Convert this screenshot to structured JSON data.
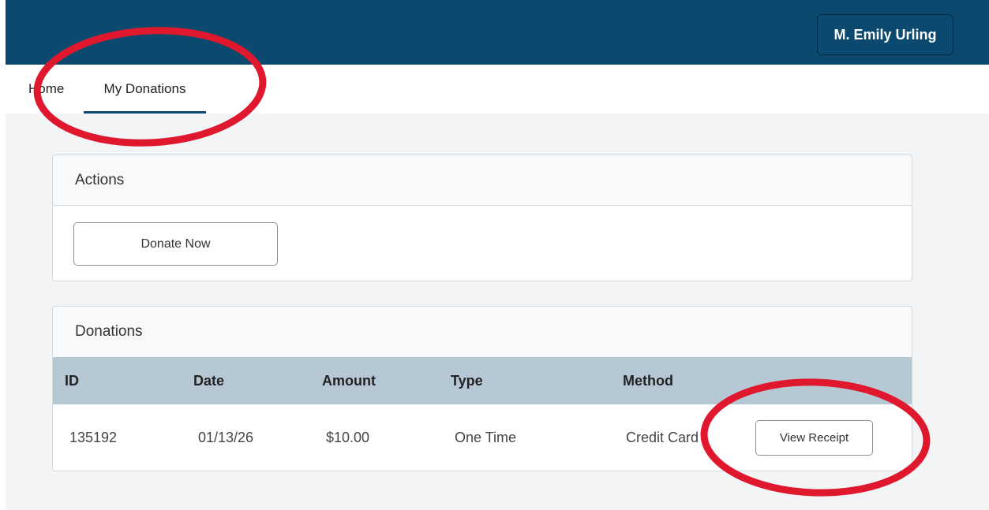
{
  "header": {
    "user_name": "M. Emily Urling",
    "brand_color": "#0b4a6e"
  },
  "nav": {
    "items": [
      {
        "label": "Home",
        "active": false
      },
      {
        "label": "My Donations",
        "active": true
      }
    ]
  },
  "actions_card": {
    "title": "Actions",
    "donate_label": "Donate Now"
  },
  "donations_card": {
    "title": "Donations",
    "columns": [
      "ID",
      "Date",
      "Amount",
      "Type",
      "Method"
    ],
    "rows": [
      {
        "id": "135192",
        "date": "01/13/26",
        "amount": "$10.00",
        "type": "One Time",
        "method": "Credit Card",
        "action_label": "View Receipt"
      }
    ]
  },
  "annotation_color": "#e0182d"
}
